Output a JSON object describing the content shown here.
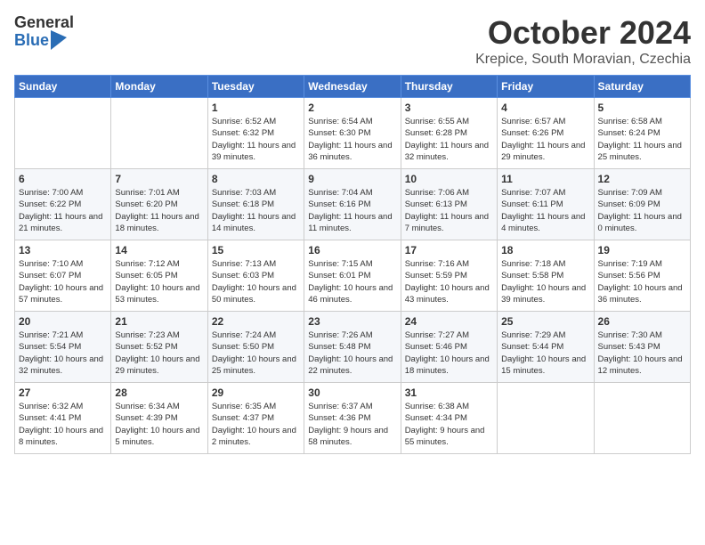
{
  "header": {
    "logo_general": "General",
    "logo_blue": "Blue",
    "month_title": "October 2024",
    "subtitle": "Krepice, South Moravian, Czechia"
  },
  "weekdays": [
    "Sunday",
    "Monday",
    "Tuesday",
    "Wednesday",
    "Thursday",
    "Friday",
    "Saturday"
  ],
  "weeks": [
    [
      {
        "day": "",
        "info": ""
      },
      {
        "day": "",
        "info": ""
      },
      {
        "day": "1",
        "info": "Sunrise: 6:52 AM\nSunset: 6:32 PM\nDaylight: 11 hours and 39 minutes."
      },
      {
        "day": "2",
        "info": "Sunrise: 6:54 AM\nSunset: 6:30 PM\nDaylight: 11 hours and 36 minutes."
      },
      {
        "day": "3",
        "info": "Sunrise: 6:55 AM\nSunset: 6:28 PM\nDaylight: 11 hours and 32 minutes."
      },
      {
        "day": "4",
        "info": "Sunrise: 6:57 AM\nSunset: 6:26 PM\nDaylight: 11 hours and 29 minutes."
      },
      {
        "day": "5",
        "info": "Sunrise: 6:58 AM\nSunset: 6:24 PM\nDaylight: 11 hours and 25 minutes."
      }
    ],
    [
      {
        "day": "6",
        "info": "Sunrise: 7:00 AM\nSunset: 6:22 PM\nDaylight: 11 hours and 21 minutes."
      },
      {
        "day": "7",
        "info": "Sunrise: 7:01 AM\nSunset: 6:20 PM\nDaylight: 11 hours and 18 minutes."
      },
      {
        "day": "8",
        "info": "Sunrise: 7:03 AM\nSunset: 6:18 PM\nDaylight: 11 hours and 14 minutes."
      },
      {
        "day": "9",
        "info": "Sunrise: 7:04 AM\nSunset: 6:16 PM\nDaylight: 11 hours and 11 minutes."
      },
      {
        "day": "10",
        "info": "Sunrise: 7:06 AM\nSunset: 6:13 PM\nDaylight: 11 hours and 7 minutes."
      },
      {
        "day": "11",
        "info": "Sunrise: 7:07 AM\nSunset: 6:11 PM\nDaylight: 11 hours and 4 minutes."
      },
      {
        "day": "12",
        "info": "Sunrise: 7:09 AM\nSunset: 6:09 PM\nDaylight: 11 hours and 0 minutes."
      }
    ],
    [
      {
        "day": "13",
        "info": "Sunrise: 7:10 AM\nSunset: 6:07 PM\nDaylight: 10 hours and 57 minutes."
      },
      {
        "day": "14",
        "info": "Sunrise: 7:12 AM\nSunset: 6:05 PM\nDaylight: 10 hours and 53 minutes."
      },
      {
        "day": "15",
        "info": "Sunrise: 7:13 AM\nSunset: 6:03 PM\nDaylight: 10 hours and 50 minutes."
      },
      {
        "day": "16",
        "info": "Sunrise: 7:15 AM\nSunset: 6:01 PM\nDaylight: 10 hours and 46 minutes."
      },
      {
        "day": "17",
        "info": "Sunrise: 7:16 AM\nSunset: 5:59 PM\nDaylight: 10 hours and 43 minutes."
      },
      {
        "day": "18",
        "info": "Sunrise: 7:18 AM\nSunset: 5:58 PM\nDaylight: 10 hours and 39 minutes."
      },
      {
        "day": "19",
        "info": "Sunrise: 7:19 AM\nSunset: 5:56 PM\nDaylight: 10 hours and 36 minutes."
      }
    ],
    [
      {
        "day": "20",
        "info": "Sunrise: 7:21 AM\nSunset: 5:54 PM\nDaylight: 10 hours and 32 minutes."
      },
      {
        "day": "21",
        "info": "Sunrise: 7:23 AM\nSunset: 5:52 PM\nDaylight: 10 hours and 29 minutes."
      },
      {
        "day": "22",
        "info": "Sunrise: 7:24 AM\nSunset: 5:50 PM\nDaylight: 10 hours and 25 minutes."
      },
      {
        "day": "23",
        "info": "Sunrise: 7:26 AM\nSunset: 5:48 PM\nDaylight: 10 hours and 22 minutes."
      },
      {
        "day": "24",
        "info": "Sunrise: 7:27 AM\nSunset: 5:46 PM\nDaylight: 10 hours and 18 minutes."
      },
      {
        "day": "25",
        "info": "Sunrise: 7:29 AM\nSunset: 5:44 PM\nDaylight: 10 hours and 15 minutes."
      },
      {
        "day": "26",
        "info": "Sunrise: 7:30 AM\nSunset: 5:43 PM\nDaylight: 10 hours and 12 minutes."
      }
    ],
    [
      {
        "day": "27",
        "info": "Sunrise: 6:32 AM\nSunset: 4:41 PM\nDaylight: 10 hours and 8 minutes."
      },
      {
        "day": "28",
        "info": "Sunrise: 6:34 AM\nSunset: 4:39 PM\nDaylight: 10 hours and 5 minutes."
      },
      {
        "day": "29",
        "info": "Sunrise: 6:35 AM\nSunset: 4:37 PM\nDaylight: 10 hours and 2 minutes."
      },
      {
        "day": "30",
        "info": "Sunrise: 6:37 AM\nSunset: 4:36 PM\nDaylight: 9 hours and 58 minutes."
      },
      {
        "day": "31",
        "info": "Sunrise: 6:38 AM\nSunset: 4:34 PM\nDaylight: 9 hours and 55 minutes."
      },
      {
        "day": "",
        "info": ""
      },
      {
        "day": "",
        "info": ""
      }
    ]
  ]
}
